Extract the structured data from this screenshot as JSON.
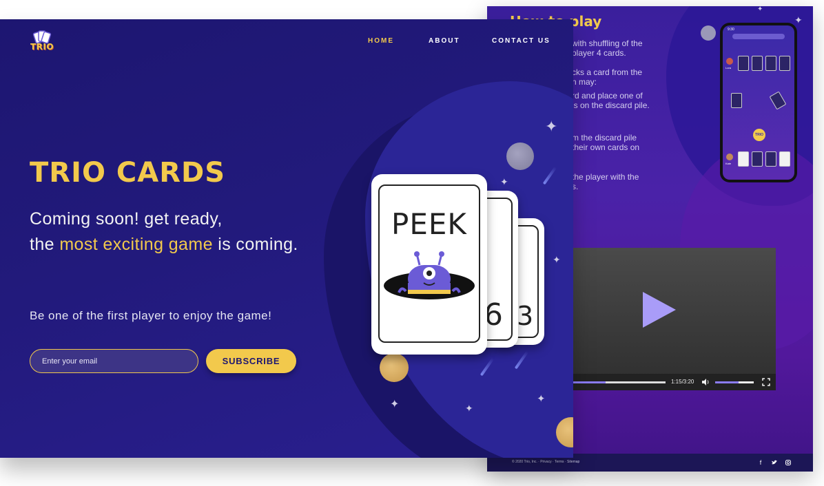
{
  "colors": {
    "accent": "#f2c94c",
    "hero_bg": "#1d1671",
    "purple": "#8b7cf6"
  },
  "nav": {
    "home": "HOME",
    "about": "ABOUT",
    "contact": "CONTACT US"
  },
  "logo": {
    "text": "TRIO"
  },
  "hero": {
    "title": "TRIO CARDS",
    "tagline_line1": "Coming soon! get ready,",
    "tagline_pre": "the ",
    "tagline_highlight": "most exciting game",
    "tagline_post": " is coming.",
    "sub": "Be one of the first player to enjoy the game!"
  },
  "subscribe": {
    "placeholder": "Enter your email",
    "button_label": "SUBSCRIBE"
  },
  "cards": {
    "front_word": "PEEK",
    "middle_number": "6",
    "back_number": "3"
  },
  "howto": {
    "title": "How to play",
    "lines": [
      "with shuffling of the",
      "player 4 cards.",
      "cks a card from the",
      "n may:",
      "rd and place one of",
      "ls on the discard pile.",
      "m the discard pile",
      "their own cards on",
      "the player with the",
      "s."
    ]
  },
  "phone": {
    "time": "9:30",
    "player_top": "Lora",
    "player_bottom": "Kate",
    "chip": "TRIO"
  },
  "video": {
    "time": "1:15/3:20",
    "progress": 0.37,
    "volume": 0.6
  },
  "footer": {
    "text": "© 2020 Trio, Inc. · Privacy · Terms · Sitemap",
    "icons": [
      "facebook-icon",
      "twitter-icon",
      "instagram-icon"
    ]
  }
}
